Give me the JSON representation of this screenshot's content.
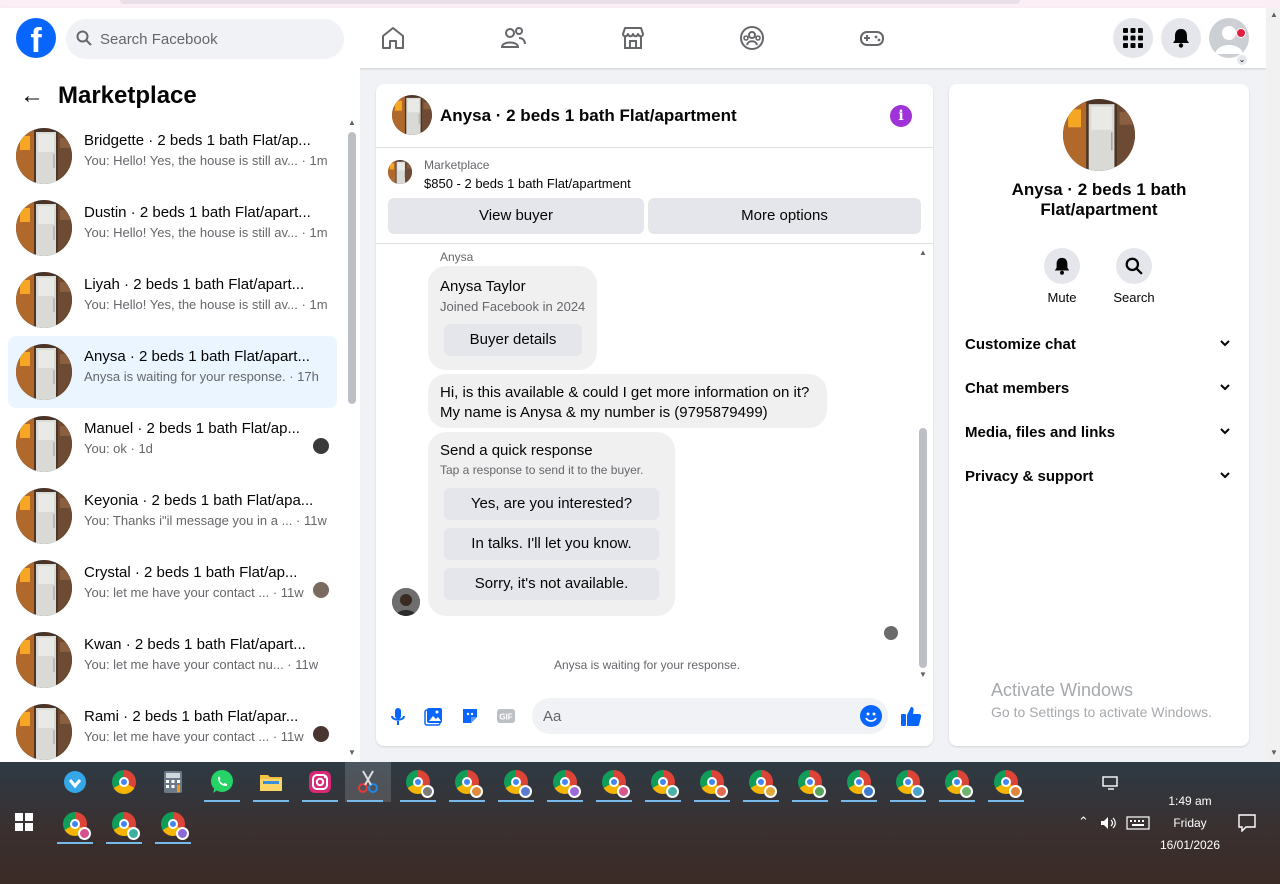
{
  "header": {
    "logo": "f",
    "search_placeholder": "Search Facebook",
    "nav_icons": [
      "home-icon",
      "friends-icon",
      "marketplace-icon",
      "groups-icon",
      "gaming-icon"
    ],
    "right_icons": [
      "menu-grid-icon",
      "notifications-icon",
      "account-avatar"
    ]
  },
  "sidebar": {
    "title": "Marketplace",
    "conversations": [
      {
        "title": "Bridgette · 2 beds 1 bath Flat/ap...",
        "preview": "You: Hello! Yes, the house is still av... · 1m"
      },
      {
        "title": "Dustin · 2 beds 1 bath Flat/apart...",
        "preview": "You: Hello! Yes, the house is still av... · 1m"
      },
      {
        "title": "Liyah · 2 beds 1 bath Flat/apart...",
        "preview": "You: Hello! Yes, the house is still av... · 1m"
      },
      {
        "title": "Anysa · 2 beds 1 bath Flat/apart...",
        "preview": "Anysa is waiting for your response. · 17h"
      },
      {
        "title": "Manuel · 2 beds 1 bath Flat/ap...",
        "preview": "You: ok · 1d"
      },
      {
        "title": "Keyonia · 2 beds 1 bath Flat/apa...",
        "preview": "You: Thanks i\"il message you in a ... · 11w"
      },
      {
        "title": "Crystal · 2 beds 1 bath Flat/ap...",
        "preview": "You: let me have your contact ... · 11w"
      },
      {
        "title": "Kwan · 2 beds 1 bath Flat/apart...",
        "preview": "You: let me have your contact nu... · 11w"
      },
      {
        "title": "Rami · 2 beds 1 bath Flat/apar...",
        "preview": "You: let me have your contact ... · 11w"
      }
    ]
  },
  "chat": {
    "title": "Anysa · 2 beds 1 bath Flat/apartment",
    "listing_label": "Marketplace",
    "listing_price": "$850 - 2 beds 1 bath Flat/apartment",
    "view_buyer": "View buyer",
    "more_options": "More options",
    "sender_label": "Anysa",
    "profile_name": "Anysa Taylor",
    "profile_joined": "Joined Facebook in 2024",
    "buyer_details": "Buyer details",
    "message_line1": "Hi, is this available & could I get more information on it?",
    "message_line2": "My name is Anysa & my number is (9795879499)",
    "quick_title": "Send a quick response",
    "quick_sub": "Tap a response to send it to the buyer.",
    "quick_replies": [
      "Yes, are you interested?",
      "In talks. I'll let you know.",
      "Sorry, it's not available."
    ],
    "waiting": "Anysa is waiting for your response.",
    "composer_placeholder": "Aa"
  },
  "details": {
    "name": "Anysa · 2 beds 1 bath Flat/apartment",
    "mute": "Mute",
    "search": "Search",
    "sections": [
      "Customize chat",
      "Chat members",
      "Media, files and links",
      "Privacy & support"
    ]
  },
  "watermark": {
    "line1": "Activate Windows",
    "line2": "Go to Settings to activate Windows."
  },
  "taskbar": {
    "time": "1:49 am",
    "day": "Friday",
    "date": "16/01/2026"
  },
  "colors": {
    "brand": "#0866ff",
    "info": "#a033d8",
    "active_row": "#ebf5ff"
  }
}
